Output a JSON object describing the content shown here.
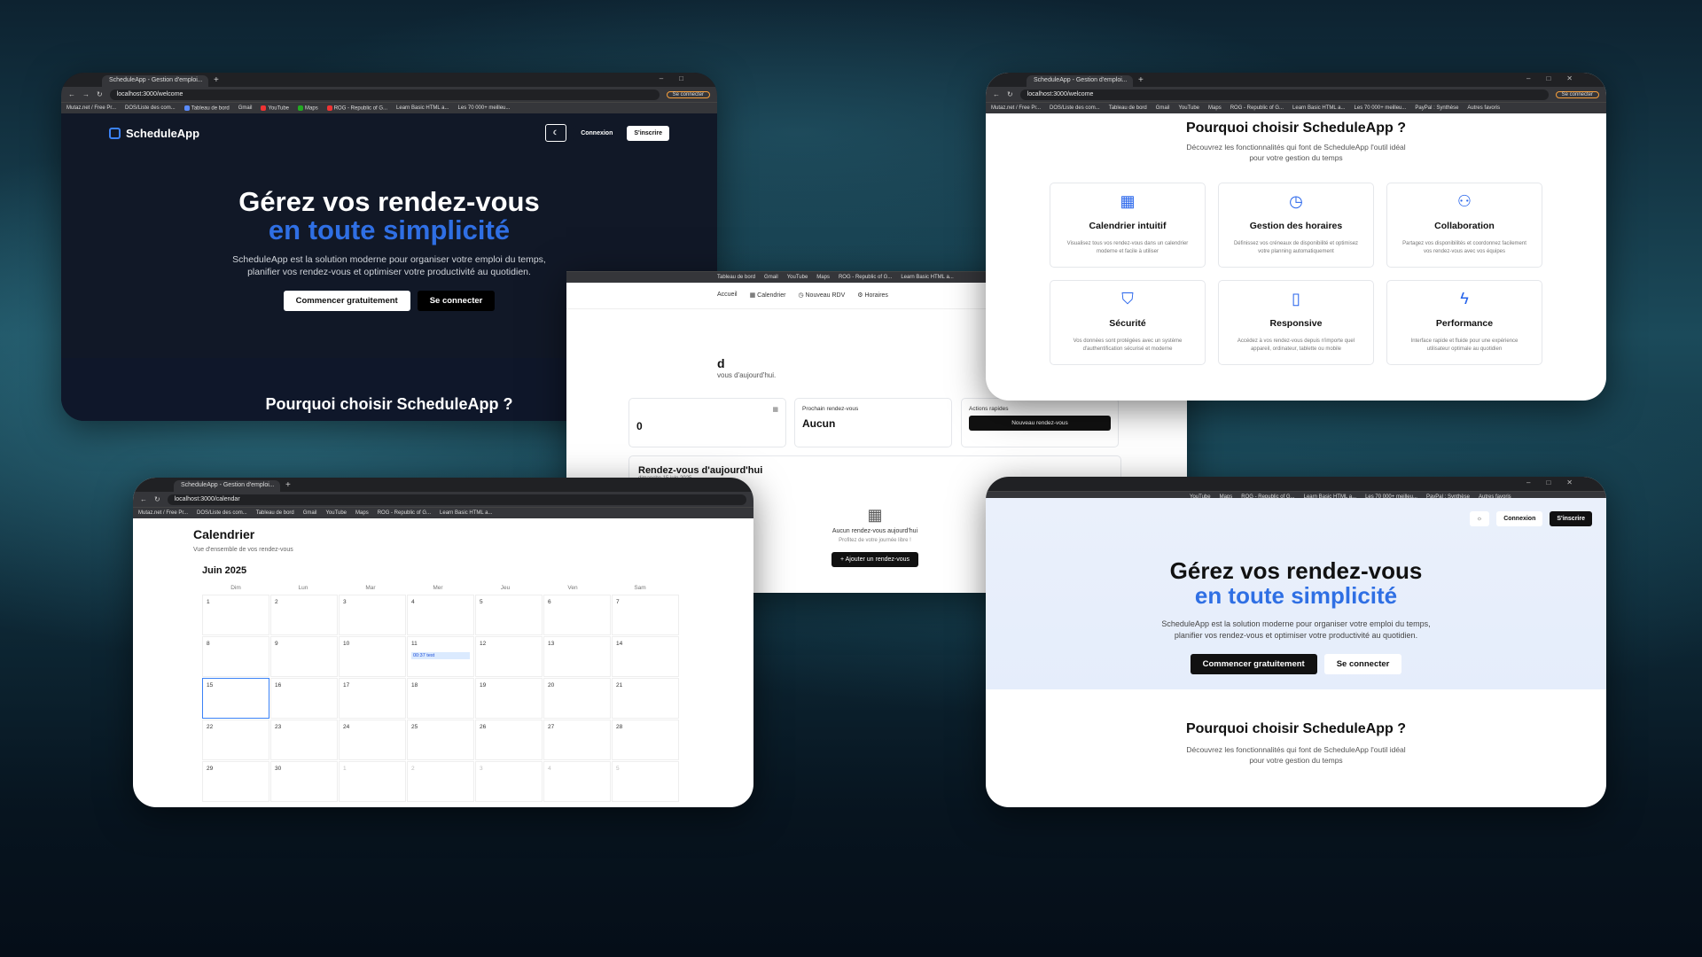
{
  "browser": {
    "tab_title": "ScheduleApp - Gestion d'emploi...",
    "url_welcome": "localhost:3000/welcome",
    "url_calendar": "localhost:3000/calendar",
    "profile_button": "Se connecter",
    "bookmarks": [
      "Mutaz.net / Free Pr...",
      "DOS/Liste des com...",
      "Tableau de bord",
      "Gmail",
      "YouTube",
      "Maps",
      "ROG - Republic of G...",
      "Learn Basic HTML a...",
      "Les 70 000+ meilleu...",
      "PayPal : Synthèse"
    ],
    "other_bookmarks": "Autres favoris"
  },
  "app": {
    "name": "ScheduleApp",
    "login": "Connexion",
    "signup": "S'inscrire",
    "hero_line1": "Gérez vos rendez-vous",
    "hero_line2": "en toute simplicité",
    "hero_desc_1": "ScheduleApp est la solution moderne pour organiser votre emploi du temps,",
    "hero_desc_2": "planifier vos rendez-vous et optimiser votre productivité au quotidien.",
    "cta_primary": "Commencer gratuitement",
    "cta_secondary": "Se connecter",
    "why_title": "Pourquoi choisir ScheduleApp ?",
    "why_desc_1": "Découvrez les fonctionnalités qui font de ScheduleApp l'outil idéal",
    "why_desc_2": "pour votre gestion du temps"
  },
  "features": [
    {
      "icon": "calendar-icon",
      "title": "Calendrier intuitif",
      "desc": "Visualisez tous vos rendez-vous dans un calendrier moderne et facile à utiliser"
    },
    {
      "icon": "clock-icon",
      "title": "Gestion des horaires",
      "desc": "Définissez vos créneaux de disponibilité et optimisez votre planning automatiquement"
    },
    {
      "icon": "users-icon",
      "title": "Collaboration",
      "desc": "Partagez vos disponibilités et coordonnez facilement vos rendez-vous avec vos équipes"
    },
    {
      "icon": "shield-icon",
      "title": "Sécurité",
      "desc": "Vos données sont protégées avec un système d'authentification sécurisé et moderne"
    },
    {
      "icon": "phone-icon",
      "title": "Responsive",
      "desc": "Accédez à vos rendez-vous depuis n'importe quel appareil, ordinateur, tablette ou mobile"
    },
    {
      "icon": "bolt-icon",
      "title": "Performance",
      "desc": "Interface rapide et fluide pour une expérience utilisateur optimale au quotidien"
    }
  ],
  "dashboard": {
    "nav": [
      "Accueil",
      "Calendrier",
      "Nouveau RDV",
      "Horaires"
    ],
    "title_partial": "d",
    "subtitle_partial": "vous d'aujourd'hui.",
    "count_value": "0",
    "next_label": "Prochain rendez-vous",
    "next_value": "Aucun",
    "quick_label": "Actions rapides",
    "quick_button": "Nouveau rendez-vous",
    "today_title": "Rendez-vous d'aujourd'hui",
    "today_date": "dimanche 15 juin 2025",
    "empty_title": "Aucun rendez-vous aujourd'hui",
    "empty_sub": "Profitez de votre journée libre !",
    "add_button": "+   Ajouter un rendez-vous"
  },
  "calendar": {
    "title": "Calendrier",
    "subtitle": "Vue d'ensemble de vos rendez-vous",
    "month": "Juin 2025",
    "dow": [
      "Dim",
      "Lun",
      "Mar",
      "Mer",
      "Jeu",
      "Ven",
      "Sam"
    ],
    "days": [
      "1",
      "2",
      "3",
      "4",
      "5",
      "6",
      "7",
      "8",
      "9",
      "10",
      "11",
      "12",
      "13",
      "14",
      "15",
      "16",
      "17",
      "18",
      "19",
      "20",
      "21",
      "22",
      "23",
      "24",
      "25",
      "26",
      "27",
      "28",
      "29",
      "30",
      "1",
      "2",
      "3",
      "4",
      "5"
    ],
    "event": "00:37 test",
    "today": "15"
  },
  "colors": {
    "accent": "#2563eb",
    "dark_bg": "#111827"
  }
}
